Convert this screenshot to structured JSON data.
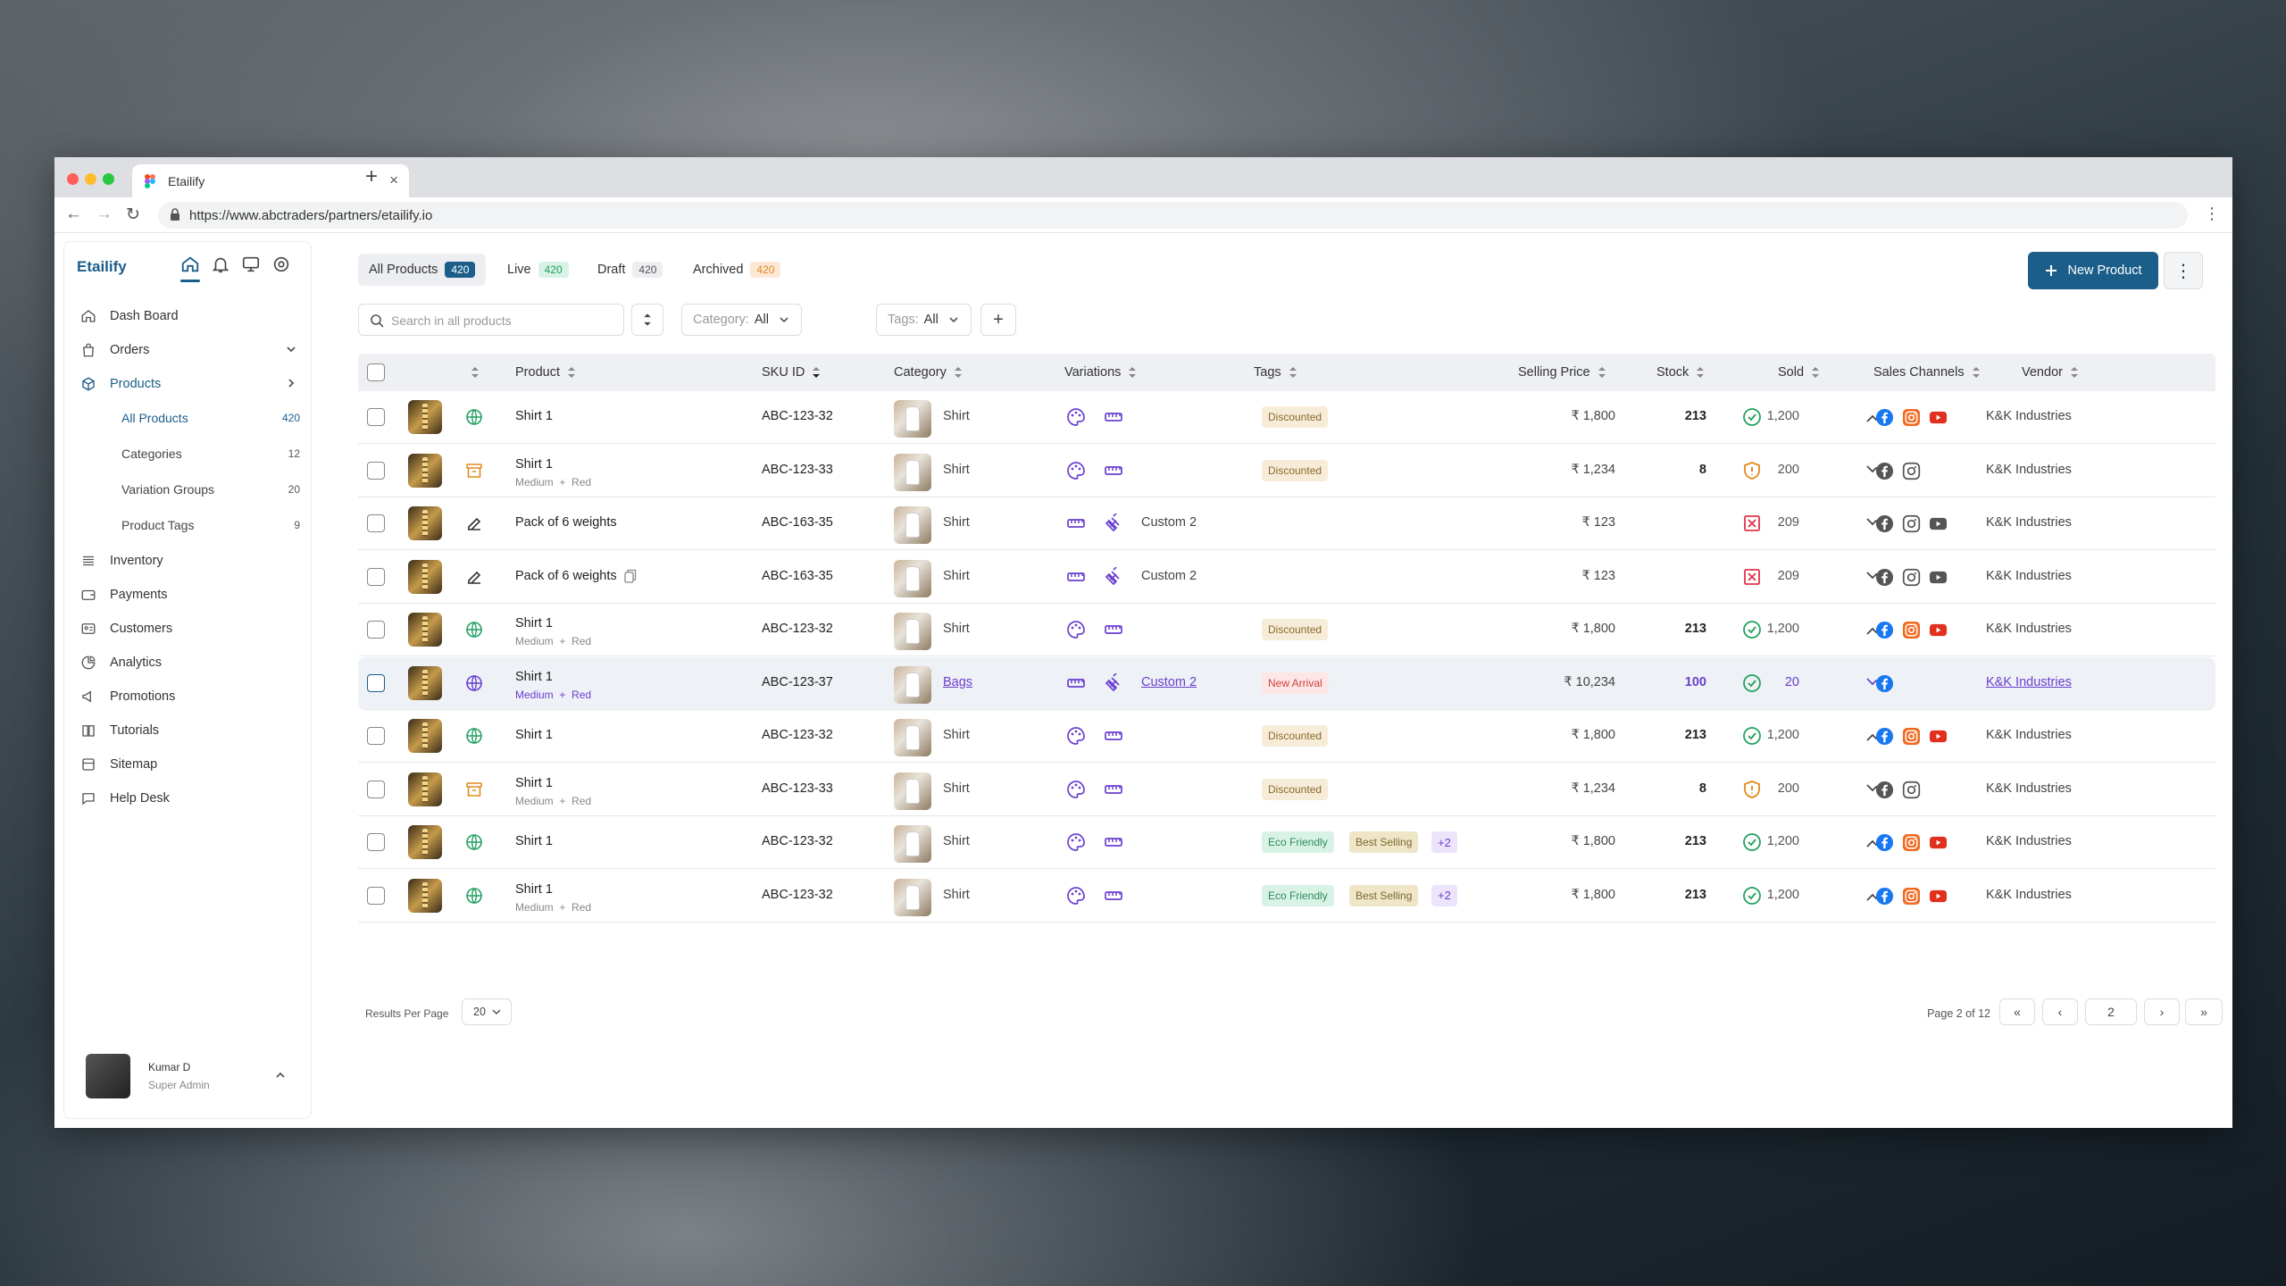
{
  "browser": {
    "tab_title": "Etailify",
    "url": "https://www.abctraders/partners/etailify.io"
  },
  "sidebar": {
    "brand": "Etailify",
    "items": [
      {
        "label": "Dash Board",
        "icon": "home-icon"
      },
      {
        "label": "Orders",
        "icon": "bag-icon"
      },
      {
        "label": "Products",
        "icon": "cube-icon"
      },
      {
        "label": "Inventory",
        "icon": "layers-icon"
      },
      {
        "label": "Payments",
        "icon": "wallet-icon"
      },
      {
        "label": "Customers",
        "icon": "id-card-icon"
      },
      {
        "label": "Analytics",
        "icon": "pie-icon"
      },
      {
        "label": "Promotions",
        "icon": "megaphone-icon"
      },
      {
        "label": "Tutorials",
        "icon": "book-icon"
      },
      {
        "label": "Sitemap",
        "icon": "sitemap-icon"
      },
      {
        "label": "Help Desk",
        "icon": "chat-icon"
      }
    ],
    "sub_items": [
      {
        "label": "All Products",
        "count": "420"
      },
      {
        "label": "Categories",
        "count": "12"
      },
      {
        "label": "Variation Groups",
        "count": "20"
      },
      {
        "label": "Product Tags",
        "count": "9"
      }
    ],
    "user": {
      "name": "Kumar D",
      "role": "Super Admin"
    }
  },
  "status_tabs": [
    {
      "label": "All Products",
      "count": "420"
    },
    {
      "label": "Live",
      "count": "420"
    },
    {
      "label": "Draft",
      "count": "420"
    },
    {
      "label": "Archived",
      "count": "420"
    }
  ],
  "toolbar": {
    "new_product": "New Product",
    "search_placeholder": "Search in all products",
    "category_label": "Category:",
    "category_value": "All",
    "tags_label": "Tags:",
    "tags_value": "All"
  },
  "table": {
    "headers": [
      "Product",
      "SKU ID",
      "Category",
      "Variations",
      "Tags",
      "Selling Price",
      "Stock",
      "Sold",
      "Sales Channels",
      "Vendor"
    ],
    "rows": [
      {
        "name": "Shirt 1",
        "variant_a": "",
        "variant_b": "",
        "sku": "ABC-123-32",
        "category": "Shirt",
        "variation_text": "",
        "price": "₹ 1,800",
        "stock": "213",
        "sold": "1,200",
        "vendor": "K&K Industries"
      },
      {
        "name": "Shirt 1",
        "variant_a": "Medium",
        "variant_b": "Red",
        "sku": "ABC-123-33",
        "category": "Shirt",
        "variation_text": "",
        "price": "₹ 1,234",
        "stock": "8",
        "sold": "200",
        "vendor": "K&K Industries"
      },
      {
        "name": "Pack of 6 weights",
        "variant_a": "",
        "variant_b": "",
        "sku": "ABC-163-35",
        "category": "Shirt",
        "variation_text": "Custom 2",
        "price": "₹ 123",
        "stock": "",
        "sold": "209",
        "vendor": "K&K Industries"
      },
      {
        "name": "Pack of 6 weights",
        "variant_a": "",
        "variant_b": "",
        "sku": "ABC-163-35",
        "category": "Shirt",
        "variation_text": "Custom 2",
        "price": "₹ 123",
        "stock": "",
        "sold": "209",
        "vendor": "K&K Industries"
      },
      {
        "name": "Shirt 1",
        "variant_a": "Medium",
        "variant_b": "Red",
        "sku": "ABC-123-32",
        "category": "Shirt",
        "variation_text": "",
        "price": "₹ 1,800",
        "stock": "213",
        "sold": "1,200",
        "vendor": "K&K Industries"
      },
      {
        "name": "Shirt 1",
        "variant_a": "Medium",
        "variant_b": "Red",
        "sku": "ABC-123-37",
        "category": "Bags",
        "variation_text": "Custom 2",
        "price": "₹ 10,234",
        "stock": "100",
        "sold": "20",
        "vendor": "K&K Industries"
      },
      {
        "name": "Shirt 1",
        "variant_a": "",
        "variant_b": "",
        "sku": "ABC-123-32",
        "category": "Shirt",
        "variation_text": "",
        "price": "₹ 1,800",
        "stock": "213",
        "sold": "1,200",
        "vendor": "K&K Industries"
      },
      {
        "name": "Shirt 1",
        "variant_a": "Medium",
        "variant_b": "Red",
        "sku": "ABC-123-33",
        "category": "Shirt",
        "variation_text": "",
        "price": "₹ 1,234",
        "stock": "8",
        "sold": "200",
        "vendor": "K&K Industries"
      },
      {
        "name": "Shirt 1",
        "variant_a": "",
        "variant_b": "",
        "sku": "ABC-123-32",
        "category": "Shirt",
        "variation_text": "",
        "price": "₹ 1,800",
        "stock": "213",
        "sold": "1,200",
        "vendor": "K&K Industries"
      },
      {
        "name": "Shirt 1",
        "variant_a": "Medium",
        "variant_b": "Red",
        "sku": "ABC-123-32",
        "category": "Shirt",
        "variation_text": "",
        "price": "₹ 1,800",
        "stock": "213",
        "sold": "1,200",
        "vendor": "K&K Industries"
      }
    ]
  },
  "tags": {
    "discounted": "Discounted",
    "eco": "Eco Friendly",
    "best": "Best Selling",
    "more": "+2",
    "new_arrival": "New Arrival"
  },
  "pagination": {
    "results_label": "Results Per Page",
    "per_page": "20",
    "page_info": "Page 2 of 12",
    "current": "2"
  },
  "colors": {
    "primary": "#1b5e8a",
    "accent": "#6a3fd0",
    "success": "#22a060",
    "warning": "#e08a1e",
    "danger": "#e0334a"
  }
}
